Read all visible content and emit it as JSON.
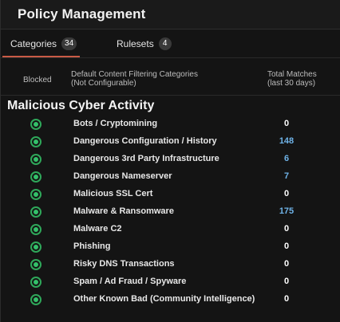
{
  "header": {
    "title": "Policy Management"
  },
  "tabs": [
    {
      "label": "Categories",
      "count": "34",
      "active": true
    },
    {
      "label": "Rulesets",
      "count": "4",
      "active": false
    }
  ],
  "columns": {
    "blocked": "Blocked",
    "categories_line1": "Default Content Filtering Categories",
    "categories_line2": "(Not Configurable)",
    "matches_line1": "Total Matches",
    "matches_line2": "(last 30 days)"
  },
  "section": {
    "title": "Malicious Cyber Activity"
  },
  "rows": [
    {
      "label": "Bots / Cryptomining",
      "count": "0",
      "linked": false,
      "blocked": true
    },
    {
      "label": "Dangerous Configuration / History",
      "count": "148",
      "linked": true,
      "blocked": true
    },
    {
      "label": "Dangerous 3rd Party Infrastructure",
      "count": "6",
      "linked": true,
      "blocked": true
    },
    {
      "label": "Dangerous Nameserver",
      "count": "7",
      "linked": true,
      "blocked": true
    },
    {
      "label": "Malicious SSL Cert",
      "count": "0",
      "linked": false,
      "blocked": true
    },
    {
      "label": "Malware & Ransomware",
      "count": "175",
      "linked": true,
      "blocked": true
    },
    {
      "label": "Malware C2",
      "count": "0",
      "linked": false,
      "blocked": true
    },
    {
      "label": "Phishing",
      "count": "0",
      "linked": false,
      "blocked": true
    },
    {
      "label": "Risky DNS Transactions",
      "count": "0",
      "linked": false,
      "blocked": true
    },
    {
      "label": "Spam / Ad Fraud / Spyware",
      "count": "0",
      "linked": false,
      "blocked": true
    },
    {
      "label": "Other Known Bad (Community Intelligence)",
      "count": "0",
      "linked": false,
      "blocked": true
    }
  ],
  "colors": {
    "accent_tab": "#c95b46",
    "status_green": "#34c16a",
    "link_blue": "#6fb3e8"
  },
  "icons": {
    "status": "green-check-circle-icon"
  }
}
